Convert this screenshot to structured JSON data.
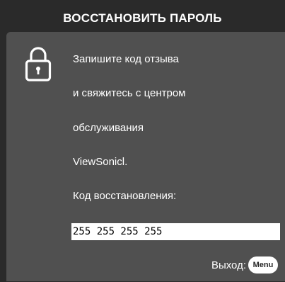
{
  "dialog": {
    "title": "ВОССТАНОВИТЬ ПАРОЛЬ",
    "lines": [
      "Запишите код отзыва",
      "и свяжитесь с центром",
      "обслуживания",
      "ViewSonicl.",
      "Код восстановления:"
    ],
    "recovery_code": "255 255 255 255",
    "exit_label": "Выход:",
    "menu_button_label": "Menu",
    "lock_icon": "lock-icon"
  },
  "colors": {
    "frame": "#2a2a2a",
    "panel": "#505050",
    "text": "#ffffff",
    "code_background": "#ffffff"
  }
}
